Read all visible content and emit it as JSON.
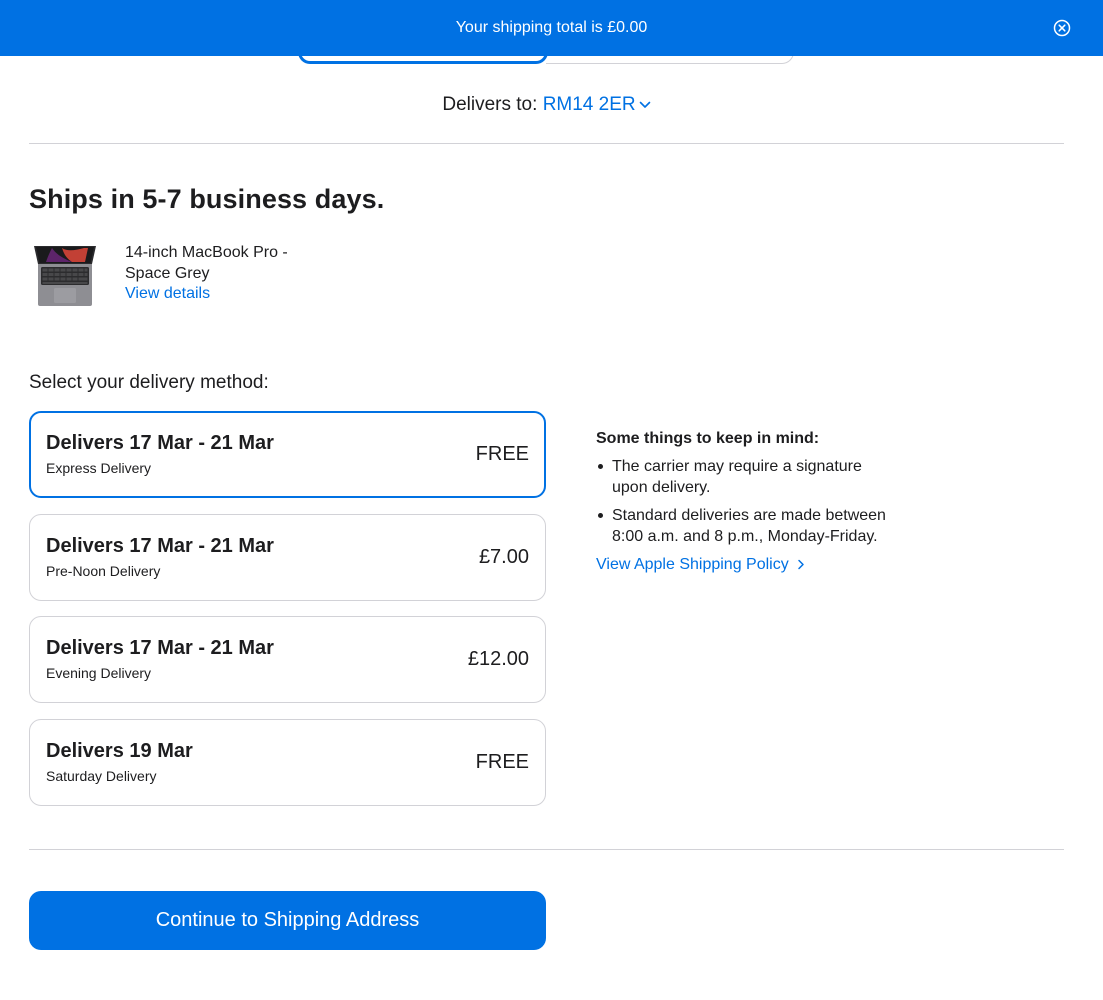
{
  "banner": {
    "text": "Your shipping total is £0.00",
    "close_icon": "close-circle-icon"
  },
  "delivers_to": {
    "label": "Delivers to:",
    "postcode": "RM14 2ER",
    "icon": "chevron-down-icon"
  },
  "ships_heading": "Ships in 5-7 business days.",
  "product": {
    "name": "14-inch MacBook Pro - Space Grey",
    "view_details": "View details",
    "image_icon": "macbook-icon"
  },
  "delivery": {
    "select_label": "Select your delivery method:",
    "options": [
      {
        "title": "Delivers 17 Mar - 21 Mar",
        "subtitle": "Express Delivery",
        "price": "FREE",
        "selected": true
      },
      {
        "title": "Delivers 17 Mar - 21 Mar",
        "subtitle": "Pre-Noon Delivery",
        "price": "£7.00",
        "selected": false
      },
      {
        "title": "Delivers 17 Mar - 21 Mar",
        "subtitle": "Evening Delivery",
        "price": "£12.00",
        "selected": false
      },
      {
        "title": "Delivers 19 Mar",
        "subtitle": "Saturday Delivery",
        "price": "FREE",
        "selected": false
      }
    ]
  },
  "info": {
    "heading": "Some things to keep in mind:",
    "items": [
      "The carrier may require a signature upon delivery.",
      "Standard deliveries are made between 8:00 a.m. and 8 p.m., Monday-Friday."
    ],
    "policy_link": "View Apple Shipping Policy",
    "policy_icon": "chevron-right-icon"
  },
  "continue_button": "Continue to Shipping Address",
  "colors": {
    "accent": "#0071e3",
    "text": "#1d1d1f",
    "border": "#d2d2d7"
  }
}
